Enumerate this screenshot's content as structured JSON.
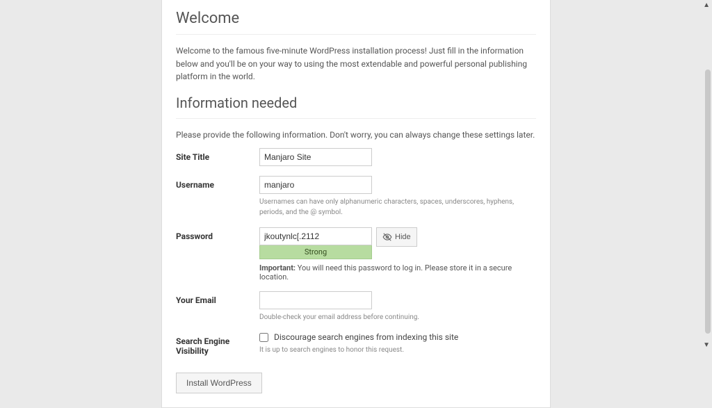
{
  "headings": {
    "welcome": "Welcome",
    "info": "Information needed"
  },
  "welcome_text": "Welcome to the famous five-minute WordPress installation process! Just fill in the information below and you'll be on your way to using the most extendable and powerful personal publishing platform in the world.",
  "info_text": "Please provide the following information. Don't worry, you can always change these settings later.",
  "fields": {
    "site_title": {
      "label": "Site Title",
      "value": "Manjaro Site"
    },
    "username": {
      "label": "Username",
      "value": "manjaro",
      "hint": "Usernames can have only alphanumeric characters, spaces, underscores, hyphens, periods, and the @ symbol."
    },
    "password": {
      "label": "Password",
      "value": "jkoutynlc[.2112",
      "strength": "Strong",
      "hide_label": "Hide",
      "important_prefix": "Important:",
      "important_text": " You will need this password to log in. Please store it in a secure location."
    },
    "email": {
      "label": "Your Email",
      "value": "",
      "hint": "Double-check your email address before continuing."
    },
    "search_visibility": {
      "label": "Search Engine Visibility",
      "checkbox_label": "Discourage search engines from indexing this site",
      "hint": "It is up to search engines to honor this request."
    }
  },
  "install_button": "Install WordPress"
}
